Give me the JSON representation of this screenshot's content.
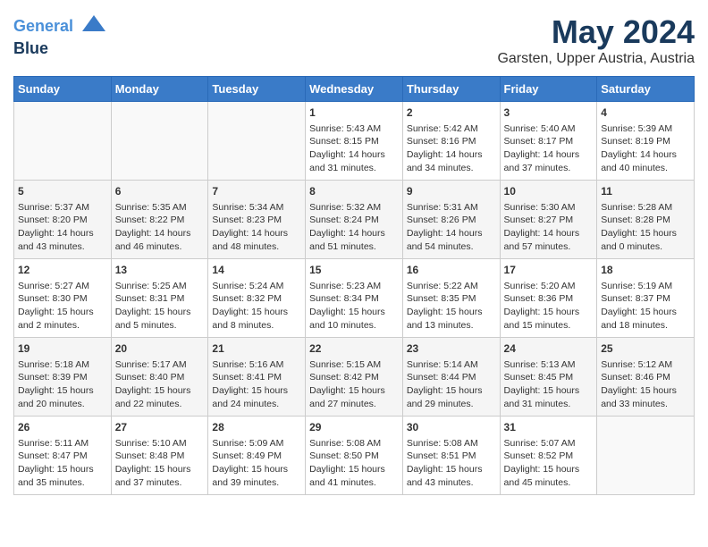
{
  "header": {
    "logo_line1": "General",
    "logo_line2": "Blue",
    "month_title": "May 2024",
    "subtitle": "Garsten, Upper Austria, Austria"
  },
  "weekdays": [
    "Sunday",
    "Monday",
    "Tuesday",
    "Wednesday",
    "Thursday",
    "Friday",
    "Saturday"
  ],
  "weeks": [
    [
      {
        "day": "",
        "content": ""
      },
      {
        "day": "",
        "content": ""
      },
      {
        "day": "",
        "content": ""
      },
      {
        "day": "1",
        "content": "Sunrise: 5:43 AM\nSunset: 8:15 PM\nDaylight: 14 hours\nand 31 minutes."
      },
      {
        "day": "2",
        "content": "Sunrise: 5:42 AM\nSunset: 8:16 PM\nDaylight: 14 hours\nand 34 minutes."
      },
      {
        "day": "3",
        "content": "Sunrise: 5:40 AM\nSunset: 8:17 PM\nDaylight: 14 hours\nand 37 minutes."
      },
      {
        "day": "4",
        "content": "Sunrise: 5:39 AM\nSunset: 8:19 PM\nDaylight: 14 hours\nand 40 minutes."
      }
    ],
    [
      {
        "day": "5",
        "content": "Sunrise: 5:37 AM\nSunset: 8:20 PM\nDaylight: 14 hours\nand 43 minutes."
      },
      {
        "day": "6",
        "content": "Sunrise: 5:35 AM\nSunset: 8:22 PM\nDaylight: 14 hours\nand 46 minutes."
      },
      {
        "day": "7",
        "content": "Sunrise: 5:34 AM\nSunset: 8:23 PM\nDaylight: 14 hours\nand 48 minutes."
      },
      {
        "day": "8",
        "content": "Sunrise: 5:32 AM\nSunset: 8:24 PM\nDaylight: 14 hours\nand 51 minutes."
      },
      {
        "day": "9",
        "content": "Sunrise: 5:31 AM\nSunset: 8:26 PM\nDaylight: 14 hours\nand 54 minutes."
      },
      {
        "day": "10",
        "content": "Sunrise: 5:30 AM\nSunset: 8:27 PM\nDaylight: 14 hours\nand 57 minutes."
      },
      {
        "day": "11",
        "content": "Sunrise: 5:28 AM\nSunset: 8:28 PM\nDaylight: 15 hours\nand 0 minutes."
      }
    ],
    [
      {
        "day": "12",
        "content": "Sunrise: 5:27 AM\nSunset: 8:30 PM\nDaylight: 15 hours\nand 2 minutes."
      },
      {
        "day": "13",
        "content": "Sunrise: 5:25 AM\nSunset: 8:31 PM\nDaylight: 15 hours\nand 5 minutes."
      },
      {
        "day": "14",
        "content": "Sunrise: 5:24 AM\nSunset: 8:32 PM\nDaylight: 15 hours\nand 8 minutes."
      },
      {
        "day": "15",
        "content": "Sunrise: 5:23 AM\nSunset: 8:34 PM\nDaylight: 15 hours\nand 10 minutes."
      },
      {
        "day": "16",
        "content": "Sunrise: 5:22 AM\nSunset: 8:35 PM\nDaylight: 15 hours\nand 13 minutes."
      },
      {
        "day": "17",
        "content": "Sunrise: 5:20 AM\nSunset: 8:36 PM\nDaylight: 15 hours\nand 15 minutes."
      },
      {
        "day": "18",
        "content": "Sunrise: 5:19 AM\nSunset: 8:37 PM\nDaylight: 15 hours\nand 18 minutes."
      }
    ],
    [
      {
        "day": "19",
        "content": "Sunrise: 5:18 AM\nSunset: 8:39 PM\nDaylight: 15 hours\nand 20 minutes."
      },
      {
        "day": "20",
        "content": "Sunrise: 5:17 AM\nSunset: 8:40 PM\nDaylight: 15 hours\nand 22 minutes."
      },
      {
        "day": "21",
        "content": "Sunrise: 5:16 AM\nSunset: 8:41 PM\nDaylight: 15 hours\nand 24 minutes."
      },
      {
        "day": "22",
        "content": "Sunrise: 5:15 AM\nSunset: 8:42 PM\nDaylight: 15 hours\nand 27 minutes."
      },
      {
        "day": "23",
        "content": "Sunrise: 5:14 AM\nSunset: 8:44 PM\nDaylight: 15 hours\nand 29 minutes."
      },
      {
        "day": "24",
        "content": "Sunrise: 5:13 AM\nSunset: 8:45 PM\nDaylight: 15 hours\nand 31 minutes."
      },
      {
        "day": "25",
        "content": "Sunrise: 5:12 AM\nSunset: 8:46 PM\nDaylight: 15 hours\nand 33 minutes."
      }
    ],
    [
      {
        "day": "26",
        "content": "Sunrise: 5:11 AM\nSunset: 8:47 PM\nDaylight: 15 hours\nand 35 minutes."
      },
      {
        "day": "27",
        "content": "Sunrise: 5:10 AM\nSunset: 8:48 PM\nDaylight: 15 hours\nand 37 minutes."
      },
      {
        "day": "28",
        "content": "Sunrise: 5:09 AM\nSunset: 8:49 PM\nDaylight: 15 hours\nand 39 minutes."
      },
      {
        "day": "29",
        "content": "Sunrise: 5:08 AM\nSunset: 8:50 PM\nDaylight: 15 hours\nand 41 minutes."
      },
      {
        "day": "30",
        "content": "Sunrise: 5:08 AM\nSunset: 8:51 PM\nDaylight: 15 hours\nand 43 minutes."
      },
      {
        "day": "31",
        "content": "Sunrise: 5:07 AM\nSunset: 8:52 PM\nDaylight: 15 hours\nand 45 minutes."
      },
      {
        "day": "",
        "content": ""
      }
    ]
  ]
}
